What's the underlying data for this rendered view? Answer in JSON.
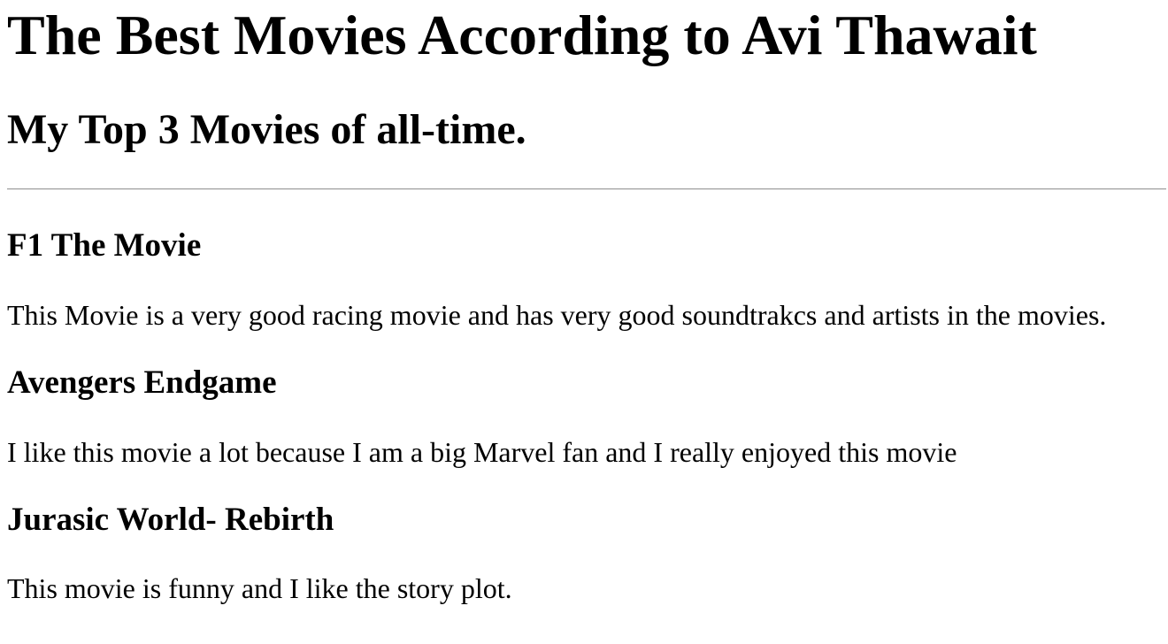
{
  "page": {
    "title": "The Best Movies According to Avi Thawait",
    "subtitle": "My Top 3 Movies of all-time."
  },
  "movies": [
    {
      "title": "F1 The Movie",
      "description": "This Movie is a very good racing movie and has very good soundtrakcs and artists in the movies."
    },
    {
      "title": "Avengers Endgame",
      "description": "I like this movie a lot because I am a big Marvel fan and I really enjoyed this movie"
    },
    {
      "title": "Jurasic World- Rebirth",
      "description": "This movie is funny and I like the story plot."
    }
  ]
}
